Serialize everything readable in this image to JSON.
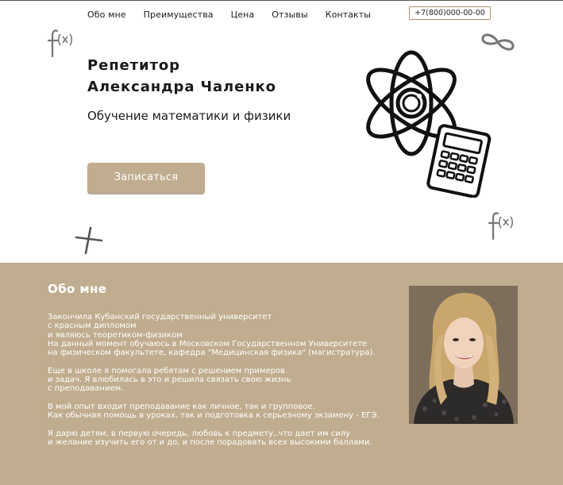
{
  "nav": {
    "items": [
      "Обо мне",
      "Преимущества",
      "Цена",
      "Отзывы",
      "Контакты"
    ],
    "phone": "+7(800)000-00-00"
  },
  "hero": {
    "title_line1": "Репетитор",
    "title_line2": "Александра Чаленко",
    "subtitle": "Обучение математики и физики",
    "cta_label": "Записаться"
  },
  "about": {
    "title": "Обо мне",
    "paragraphs": [
      [
        "Закончила Кубанский государственный университет",
        "с красным дипломом",
        "и являюсь теоретиком-физиком",
        "На данный момент обучаюсь в Московском Государственном Университете",
        "на физическом факультете, кафедра \"Медицинская физика\" (магистратура)."
      ],
      [
        "Еще в школе  я помогала ребятам с решением примеров",
        "и задач.  Я влюбилась в это и решила связать свою жизнь",
        "с преподаванием."
      ],
      [
        "В мой опыт входит преподавание как личное, так и групповое.",
        "Как обычная помощь в уроках, так и подготовка к серьезному экзамену - ЕГЭ."
      ],
      [
        "Я дарю детям, в первую очередь, любовь к предмету,.что дает им силу",
        "и желание изучить его от и до, и после порадовать всех высокими баллами."
      ]
    ]
  },
  "colors": {
    "accent": "#c0ad8f",
    "text": "#1a1a1a",
    "phone_border": "#b08f6e"
  },
  "icons": [
    "function-fx-icon",
    "infinity-icon",
    "atom-icon",
    "calculator-icon",
    "plus-icon"
  ]
}
